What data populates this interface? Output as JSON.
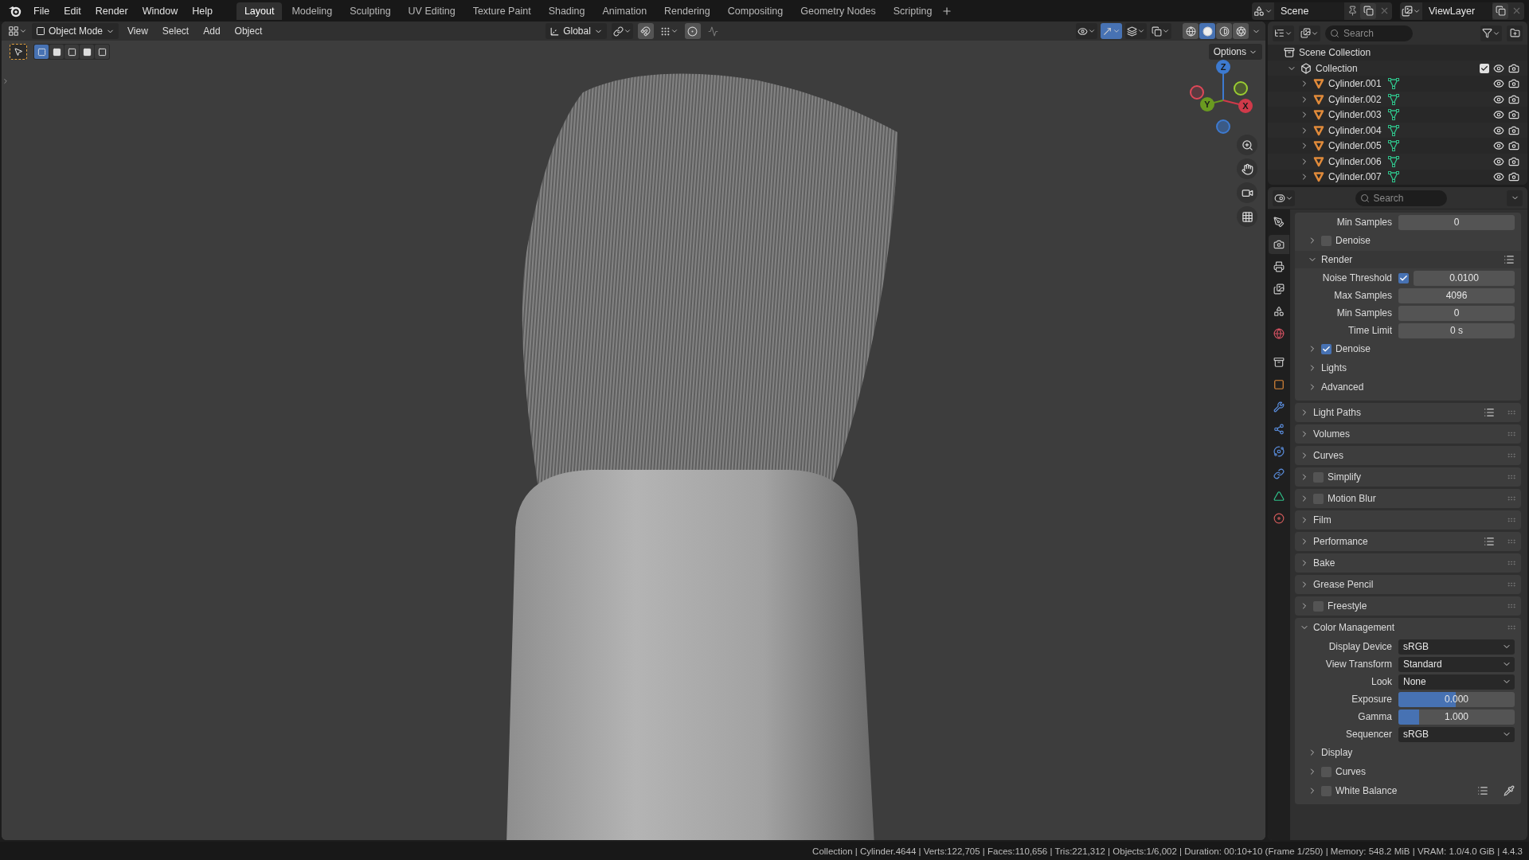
{
  "menu": [
    "File",
    "Edit",
    "Render",
    "Window",
    "Help"
  ],
  "workspaces": [
    {
      "label": "Layout",
      "selected": true
    },
    {
      "label": "Modeling",
      "selected": false
    },
    {
      "label": "Sculpting",
      "selected": false
    },
    {
      "label": "UV Editing",
      "selected": false
    },
    {
      "label": "Texture Paint",
      "selected": false
    },
    {
      "label": "Shading",
      "selected": false
    },
    {
      "label": "Animation",
      "selected": false
    },
    {
      "label": "Rendering",
      "selected": false
    },
    {
      "label": "Compositing",
      "selected": false
    },
    {
      "label": "Geometry Nodes",
      "selected": false
    },
    {
      "label": "Scripting",
      "selected": false
    }
  ],
  "scene": {
    "name": "Scene"
  },
  "view_layer": {
    "name": "ViewLayer"
  },
  "viewport": {
    "mode": "Object Mode",
    "menus": [
      "View",
      "Select",
      "Add",
      "Object"
    ],
    "orientation": "Global",
    "options": "Options",
    "select_modes": [
      {
        "selected": true
      },
      {
        "selected": false
      },
      {
        "selected": false
      },
      {
        "selected": false
      },
      {
        "selected": false
      }
    ],
    "toggles": [
      {
        "kind": "visibility",
        "on": false
      },
      {
        "kind": "gizmo",
        "on": true
      },
      {
        "kind": "overlay",
        "on": false
      },
      {
        "kind": "xray",
        "on": false
      }
    ],
    "shading": [
      {
        "kind": "wireframe",
        "selected": false
      },
      {
        "kind": "solid",
        "selected": true
      },
      {
        "kind": "material",
        "selected": false
      },
      {
        "kind": "rendered",
        "selected": false
      }
    ],
    "gizmo": [
      {
        "label": "Z"
      },
      {
        "label": "Y"
      },
      {
        "label": "X"
      }
    ]
  },
  "outliner": {
    "search_placeholder": "Search",
    "root": "Scene Collection",
    "collection": {
      "name": "Collection",
      "expanded": true,
      "checked": true,
      "children": [
        {
          "name": "Cylinder.001"
        },
        {
          "name": "Cylinder.002"
        },
        {
          "name": "Cylinder.003"
        },
        {
          "name": "Cylinder.004"
        },
        {
          "name": "Cylinder.005"
        },
        {
          "name": "Cylinder.006"
        },
        {
          "name": "Cylinder.007"
        }
      ]
    }
  },
  "properties": {
    "search_placeholder": "Search",
    "tabs": [
      {
        "kind": "tool",
        "selected": false
      },
      {
        "kind": "render",
        "selected": true
      },
      {
        "kind": "output",
        "selected": false
      },
      {
        "kind": "view_layer",
        "selected": false
      },
      {
        "kind": "scene",
        "selected": false
      },
      {
        "kind": "world",
        "selected": false
      },
      {
        "kind": "collection",
        "selected": false
      },
      {
        "kind": "object",
        "selected": false
      },
      {
        "kind": "modifiers",
        "selected": false
      },
      {
        "kind": "particles",
        "selected": false
      },
      {
        "kind": "physics",
        "selected": false
      },
      {
        "kind": "constraints",
        "selected": false
      },
      {
        "kind": "data",
        "selected": false
      },
      {
        "kind": "material",
        "selected": false
      }
    ],
    "sampling_rows": [
      {
        "kind": "field",
        "label": "Min Samples",
        "value": "0"
      },
      {
        "kind": "sub-check",
        "label": "Denoise",
        "expanded": false,
        "checked": false
      },
      {
        "kind": "sub",
        "label": "Render",
        "expanded": true,
        "presets": true
      },
      {
        "kind": "check-field",
        "label": "Noise Threshold",
        "checked": true,
        "value": "0.0100"
      },
      {
        "kind": "field",
        "label": "Max Samples",
        "value": "4096"
      },
      {
        "kind": "field",
        "label": "Min Samples",
        "value": "0"
      },
      {
        "kind": "field",
        "label": "Time Limit",
        "value": "0 s"
      },
      {
        "kind": "sub-check",
        "label": "Denoise",
        "expanded": false,
        "checked": true
      },
      {
        "kind": "sub",
        "label": "Lights",
        "expanded": false
      },
      {
        "kind": "sub",
        "label": "Advanced",
        "expanded": false
      }
    ],
    "panels": [
      {
        "kind": "plain",
        "title": "Light Paths",
        "expanded": false,
        "presets": true
      },
      {
        "kind": "plain",
        "title": "Volumes",
        "expanded": false
      },
      {
        "kind": "plain",
        "title": "Curves",
        "expanded": false
      },
      {
        "kind": "check",
        "title": "Simplify",
        "expanded": false,
        "checked": false
      },
      {
        "kind": "check",
        "title": "Motion Blur",
        "expanded": false,
        "checked": false
      },
      {
        "kind": "plain",
        "title": "Film",
        "expanded": false
      },
      {
        "kind": "plain",
        "title": "Performance",
        "expanded": false,
        "presets": true
      },
      {
        "kind": "plain",
        "title": "Bake",
        "expanded": false
      },
      {
        "kind": "plain",
        "title": "Grease Pencil",
        "expanded": false
      },
      {
        "kind": "check",
        "title": "Freestyle",
        "expanded": false,
        "checked": false
      },
      {
        "kind": "plain",
        "title": "Color Management",
        "expanded": true,
        "rows": [
          {
            "kind": "dropdown",
            "label": "Display Device",
            "value": "sRGB"
          },
          {
            "kind": "dropdown",
            "label": "View Transform",
            "value": "Standard"
          },
          {
            "kind": "dropdown",
            "label": "Look",
            "value": "None"
          },
          {
            "kind": "slider",
            "label": "Exposure",
            "value": "0.000",
            "level": 0.49
          },
          {
            "kind": "slider",
            "label": "Gamma",
            "value": "1.000",
            "level": 0.18
          },
          {
            "kind": "dropdown",
            "label": "Sequencer",
            "value": "sRGB"
          },
          {
            "kind": "sub",
            "label": "Display",
            "expanded": false
          },
          {
            "kind": "sub-check",
            "label": "Curves",
            "expanded": false,
            "checked": false
          },
          {
            "kind": "sub-check",
            "label": "White Balance",
            "expanded": false,
            "checked": false,
            "presets": true,
            "picker": true
          }
        ]
      }
    ]
  },
  "status": "Collection | Cylinder.4644 | Verts:122,705 | Faces:110,656 | Tris:221,312 | Objects:1/6,002 | Duration: 00:10+10 (Frame 1/250) | Memory: 548.2 MiB | VRAM: 1.0/4.0 GiB | 4.4.3"
}
